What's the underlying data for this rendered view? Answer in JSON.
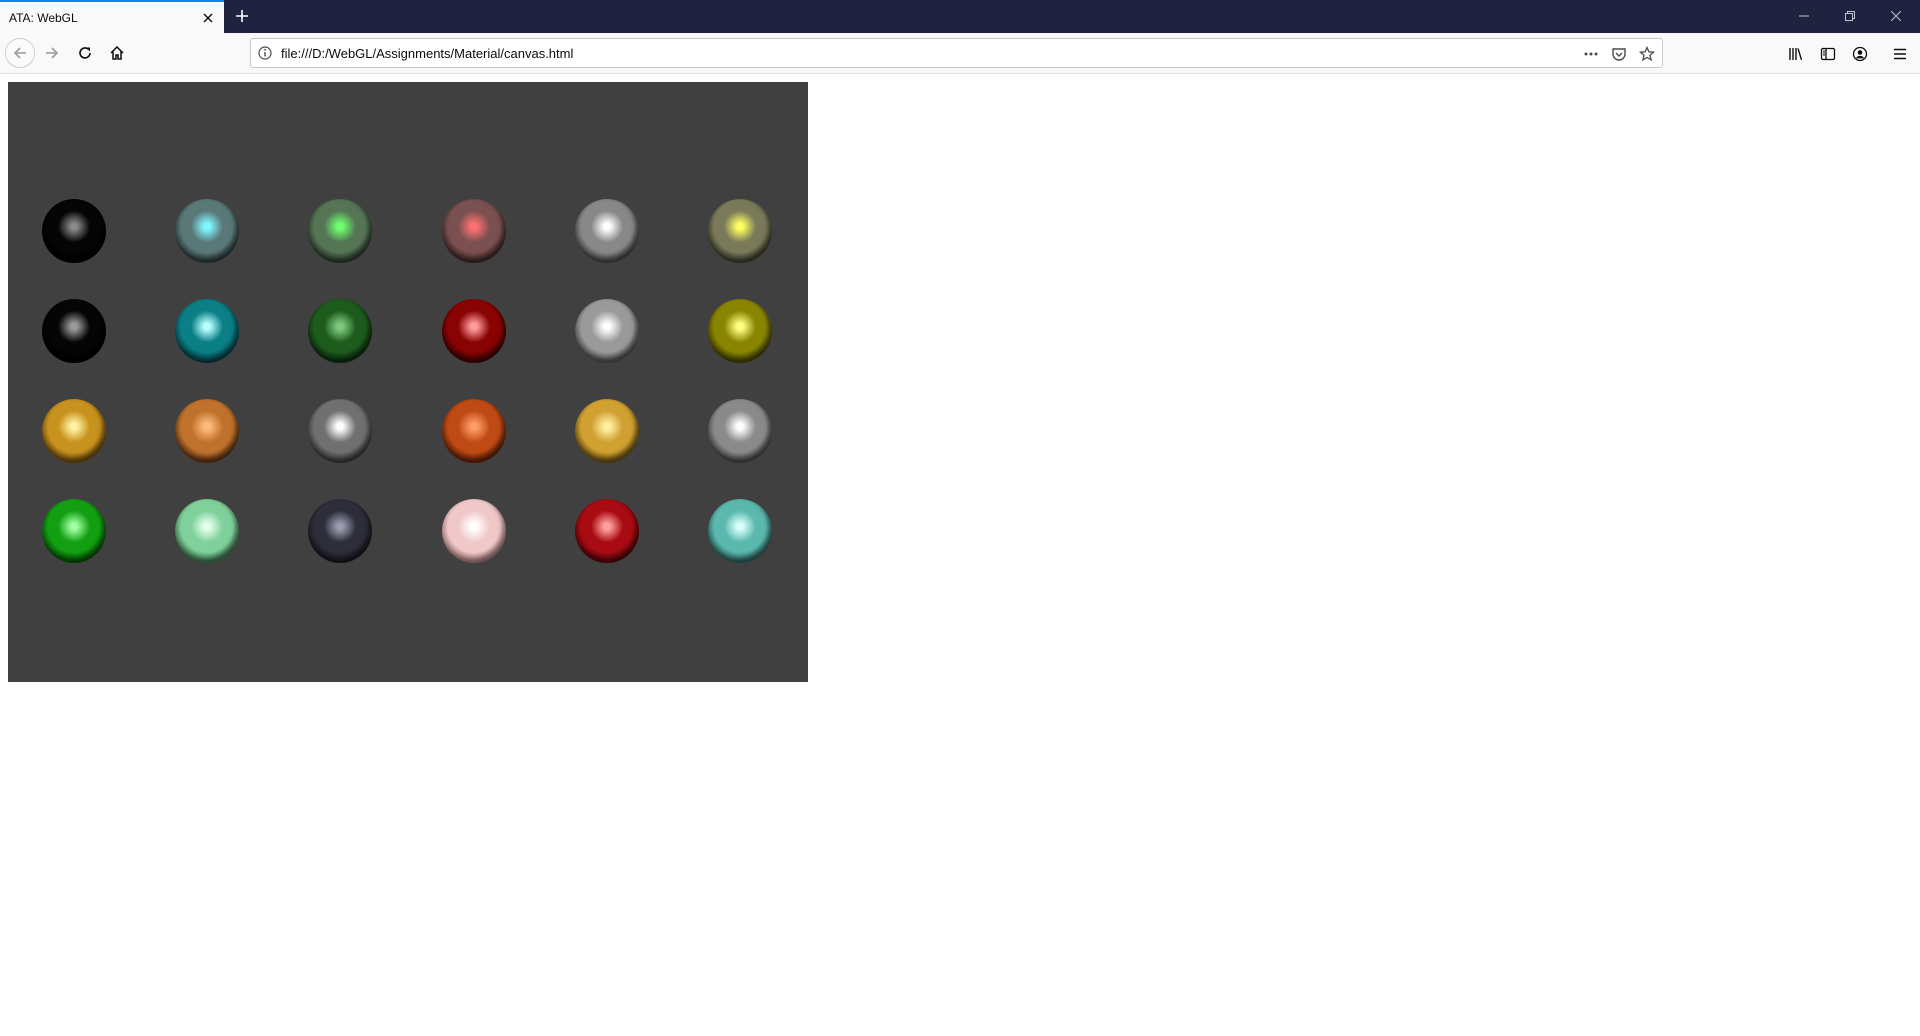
{
  "browser": {
    "tab_title": "ATA: WebGL",
    "url": "file:///D:/WebGL/Assignments/Material/canvas.html"
  },
  "icons": {
    "tab_close": "close-icon",
    "new_tab": "plus-icon",
    "minimize": "minimize-icon",
    "restore": "restore-icon",
    "close_window": "close-icon",
    "back": "arrow-left-icon",
    "forward": "arrow-right-icon",
    "reload": "reload-icon",
    "home": "home-icon",
    "site_info": "info-icon",
    "page_actions": "ellipsis-icon",
    "pocket": "pocket-icon",
    "bookmark": "star-icon",
    "library": "library-icon",
    "sidebar": "sidebar-icon",
    "account": "account-icon",
    "menu": "hamburger-icon"
  },
  "canvas": {
    "background": "#404040",
    "rows": [
      [
        {
          "base": "#050505",
          "shade": "#000000",
          "highlight": "#8a8a8a"
        },
        {
          "base": "#5a7878",
          "shade": "#2b3a3a",
          "highlight": "#7ff6ff"
        },
        {
          "base": "#557555",
          "shade": "#2a3a2a",
          "highlight": "#6dff6d"
        },
        {
          "base": "#7a5050",
          "shade": "#3d2626",
          "highlight": "#ff7070"
        },
        {
          "base": "#888888",
          "shade": "#444444",
          "highlight": "#ffffff"
        },
        {
          "base": "#7a7a5a",
          "shade": "#3c3c2c",
          "highlight": "#ffff60"
        }
      ],
      [
        {
          "base": "#050505",
          "shade": "#000000",
          "highlight": "#9a9a9a"
        },
        {
          "base": "#0a7f86",
          "shade": "#053f43",
          "highlight": "#b8ffff"
        },
        {
          "base": "#1d5c1d",
          "shade": "#0d2c0d",
          "highlight": "#7fc87f"
        },
        {
          "base": "#8a0303",
          "shade": "#400000",
          "highlight": "#ff9c9c"
        },
        {
          "base": "#9a9a9a",
          "shade": "#4d4d4d",
          "highlight": "#ffffff"
        },
        {
          "base": "#8a8500",
          "shade": "#444200",
          "highlight": "#ffff80"
        }
      ],
      [
        {
          "base": "#c8921e",
          "shade": "#6b4a0c",
          "highlight": "#fff2a0"
        },
        {
          "base": "#c0722c",
          "shade": "#5e3412",
          "highlight": "#ffb97a"
        },
        {
          "base": "#707070",
          "shade": "#383838",
          "highlight": "#ffffff"
        },
        {
          "base": "#c04a14",
          "shade": "#5e2108",
          "highlight": "#ff9d68"
        },
        {
          "base": "#d0a030",
          "shade": "#6a4f12",
          "highlight": "#fff0a0"
        },
        {
          "base": "#8a8a8a",
          "shade": "#454545",
          "highlight": "#ffffff"
        }
      ],
      [
        {
          "base": "#12a012",
          "shade": "#074f07",
          "highlight": "#a0ffa0"
        },
        {
          "base": "#7fd09a",
          "shade": "#3f704e",
          "highlight": "#e2ffec"
        },
        {
          "base": "#2e2e3a",
          "shade": "#16161d",
          "highlight": "#9a9ab0"
        },
        {
          "base": "#f0c8c8",
          "shade": "#a07878",
          "highlight": "#ffffff"
        },
        {
          "base": "#a80c12",
          "shade": "#520408",
          "highlight": "#ffa0a0"
        },
        {
          "base": "#5ab8ae",
          "shade": "#2c5c57",
          "highlight": "#d8fffa"
        }
      ]
    ]
  }
}
